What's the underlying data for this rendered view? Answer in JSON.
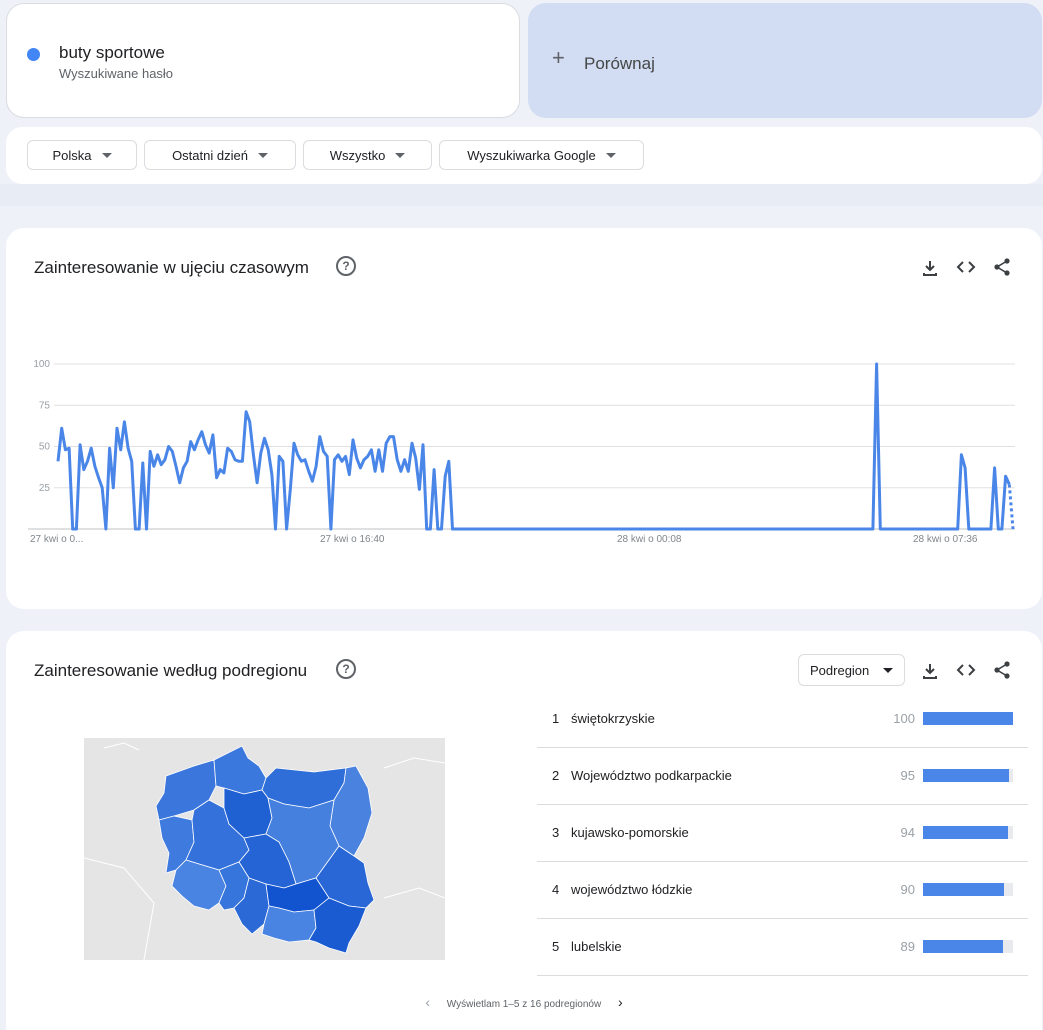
{
  "search_term": {
    "name": "buty sportowe",
    "subtitle": "Wyszukiwane hasło",
    "color": "#4285f4"
  },
  "compare": {
    "label": "Porównaj",
    "icon": "plus-icon"
  },
  "filters": [
    {
      "label": "Polska"
    },
    {
      "label": "Ostatni dzień"
    },
    {
      "label": "Wszystko"
    },
    {
      "label": "Wyszukiwarka Google"
    }
  ],
  "time_card": {
    "title": "Zainteresowanie w ujęciu czasowym",
    "actions": [
      "download-icon",
      "embed-code-icon",
      "share-icon"
    ]
  },
  "chart_data": {
    "type": "line",
    "title": "",
    "xlabel": "",
    "ylabel": "",
    "ylim": [
      0,
      100
    ],
    "y_ticks": [
      "100",
      "75",
      "50",
      "25"
    ],
    "x_ticks": [
      "27 kwi o 0...",
      "27 kwi o 16:40",
      "28 kwi o 00:08",
      "28 kwi o 07:36"
    ],
    "grid": true,
    "color": "#4a86e8",
    "series": [
      {
        "values": [
          41,
          61,
          48,
          49,
          0,
          0,
          51,
          36,
          41,
          49,
          38,
          31,
          25,
          0,
          49,
          25,
          61,
          48,
          65,
          49,
          41,
          0,
          0,
          40,
          0,
          47,
          38,
          45,
          39,
          42,
          50,
          47,
          38,
          28,
          37,
          41,
          53,
          48,
          54,
          59,
          51,
          46,
          57,
          31,
          36,
          34,
          49,
          47,
          42,
          41,
          41,
          71,
          65,
          45,
          28,
          46,
          55,
          48,
          33,
          0,
          44,
          41,
          0,
          24,
          52,
          45,
          41,
          42,
          35,
          29,
          38,
          56,
          47,
          44,
          0,
          42,
          45,
          41,
          44,
          33,
          54,
          43,
          37,
          42,
          44,
          48,
          35,
          48,
          35,
          52,
          56,
          56,
          42,
          35,
          42,
          35,
          52,
          43,
          24,
          51,
          0,
          0,
          36,
          0,
          0,
          32,
          41,
          0,
          0,
          0,
          0,
          0,
          0,
          0,
          0,
          0,
          0,
          0,
          0,
          0,
          0,
          0,
          0,
          0,
          0,
          0,
          0,
          0,
          0,
          0,
          0,
          0,
          0,
          0,
          0,
          0,
          0,
          0,
          0,
          0,
          0,
          0,
          0,
          0,
          0,
          0,
          0,
          0,
          0,
          0,
          0,
          0,
          0,
          0,
          0,
          0,
          0,
          0,
          0,
          0,
          0,
          0,
          0,
          0,
          0,
          0,
          0,
          0,
          0,
          0,
          0,
          0,
          0,
          0,
          0,
          0,
          0,
          0,
          0,
          0,
          0,
          0,
          0,
          0,
          0,
          0,
          0,
          0,
          0,
          0,
          0,
          0,
          0,
          0,
          0,
          0,
          0,
          0,
          0,
          0,
          0,
          0,
          0,
          0,
          0,
          0,
          0,
          0,
          0,
          0,
          0,
          0,
          0,
          0,
          0,
          0,
          0,
          0,
          0,
          0,
          0,
          0,
          100,
          0,
          0,
          0,
          0,
          0,
          0,
          0,
          0,
          0,
          0,
          0,
          0,
          0,
          0,
          0,
          0,
          0,
          0,
          0,
          0,
          0,
          0,
          45,
          37,
          0,
          0,
          0,
          0,
          0,
          0,
          0,
          37,
          0,
          0,
          32,
          27,
          0
        ],
        "partial_last_point": true
      }
    ]
  },
  "region_card": {
    "title": "Zainteresowanie według podregionu",
    "select_label": "Podregion",
    "actions": [
      "download-icon",
      "embed-code-icon",
      "share-icon"
    ],
    "rows": [
      {
        "rank": "1",
        "name": "świętokrzyskie",
        "value": "100"
      },
      {
        "rank": "2",
        "name": "Województwo podkarpackie",
        "value": "95"
      },
      {
        "rank": "3",
        "name": "kujawsko-pomorskie",
        "value": "94"
      },
      {
        "rank": "4",
        "name": "województwo łódzkie",
        "value": "90"
      },
      {
        "rank": "5",
        "name": "lubelskie",
        "value": "89"
      }
    ],
    "pager": "Wyświetlam 1–5 z 16 podregionów"
  },
  "map": {
    "regions": [
      {
        "id": "zachodniopomorskie",
        "color": "#3a76dc"
      },
      {
        "id": "pomorskie",
        "color": "#3b78dd"
      },
      {
        "id": "warminsko-mazurskie",
        "color": "#2f6ed9"
      },
      {
        "id": "podlaskie",
        "color": "#4a82e0"
      },
      {
        "id": "lubuskie",
        "color": "#3f7bde"
      },
      {
        "id": "wielkopolskie",
        "color": "#3471da"
      },
      {
        "id": "kujawsko-pomorskie",
        "color": "#1f60d3"
      },
      {
        "id": "mazowieckie",
        "color": "#4680df"
      },
      {
        "id": "lodzkie",
        "color": "#2564d4"
      },
      {
        "id": "lubelskie",
        "color": "#2867d5"
      },
      {
        "id": "dolnoslaskie",
        "color": "#4a84e2"
      },
      {
        "id": "opolskie",
        "color": "#3675db"
      },
      {
        "id": "slaskie",
        "color": "#2b69d6"
      },
      {
        "id": "swietokrzyskie",
        "color": "#1254cf"
      },
      {
        "id": "malopolskie",
        "color": "#4a84e2"
      },
      {
        "id": "podkarpackie",
        "color": "#1a5bd1"
      }
    ]
  }
}
